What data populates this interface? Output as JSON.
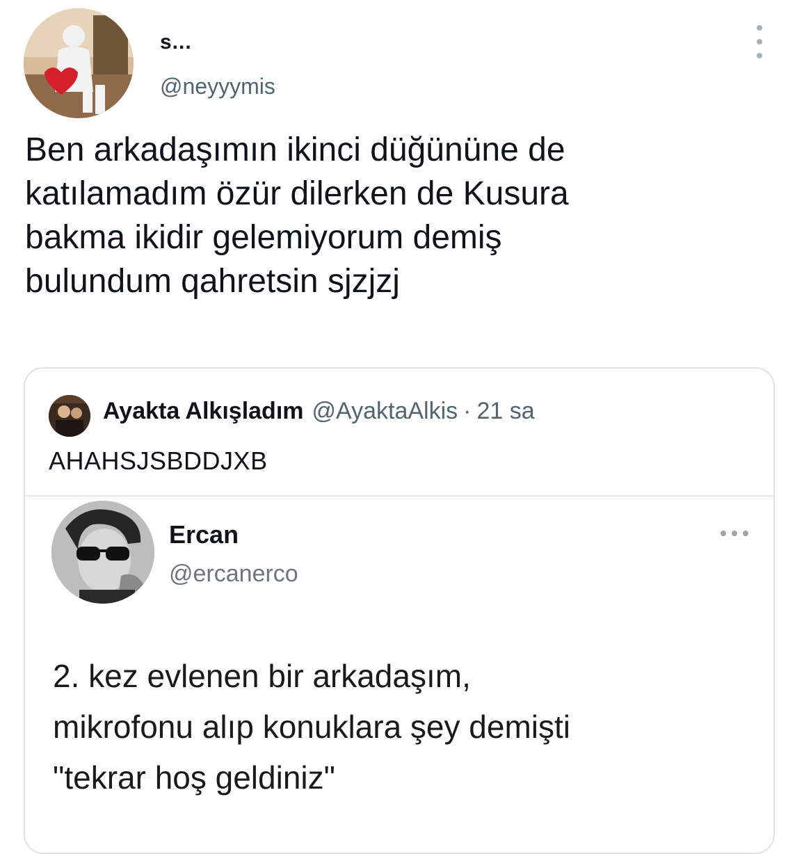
{
  "tweet": {
    "author": {
      "name": "s...",
      "handle": "@neyyymis"
    },
    "text": "Ben arkadaşımın ikinci düğününe de\nkatılamadım özür dilerken de Kusura\nbakma ikidir gelemiyorum  demiş\nbulundum qahretsin sjzjzj"
  },
  "quote": {
    "author": {
      "name": "Ayakta Alkışladım",
      "handle": "@AyaktaAlkis",
      "separator": "·",
      "time": "21 sa"
    },
    "text": "AHAHSJSBDDJXB",
    "embedded": {
      "name": "Ercan",
      "handle": "@ercanerco",
      "text": "2. kez evlenen bir arkadaşım,\nmikrofonu alıp konuklara şey demişti\n\"tekrar hoş geldiniz\""
    }
  },
  "icons": {
    "more_main": "more-vertical-icon",
    "more_embedded": "more-horizontal-icon"
  },
  "colors": {
    "text_primary": "#0f1419",
    "text_secondary": "#536471",
    "border": "#dfe3e6",
    "background": "#ffffff"
  }
}
